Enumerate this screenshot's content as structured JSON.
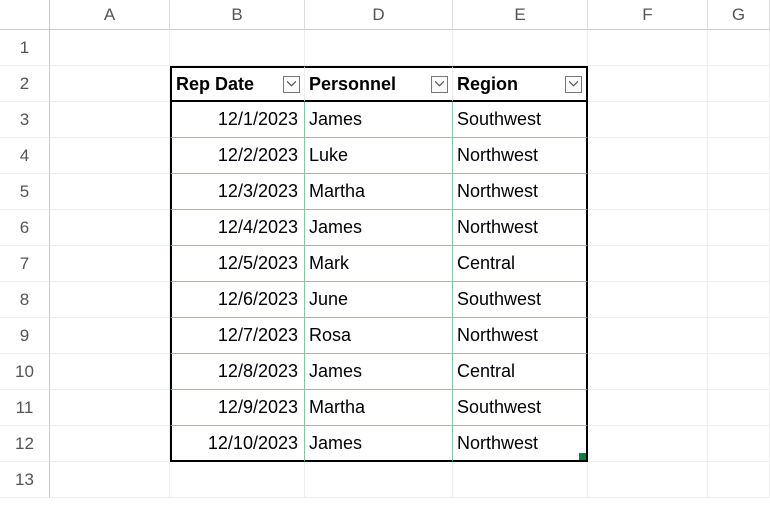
{
  "columns": [
    "A",
    "B",
    "D",
    "E",
    "F",
    "G"
  ],
  "row_numbers": [
    1,
    2,
    3,
    4,
    5,
    6,
    7,
    8,
    9,
    10,
    11,
    12,
    13
  ],
  "headers": {
    "b": "Rep Date",
    "d": "Personnel",
    "e": "Region"
  },
  "rows": [
    {
      "date": "12/1/2023",
      "personnel": "James",
      "region": "Southwest"
    },
    {
      "date": "12/2/2023",
      "personnel": "Luke",
      "region": "Northwest"
    },
    {
      "date": "12/3/2023",
      "personnel": "Martha",
      "region": "Northwest"
    },
    {
      "date": "12/4/2023",
      "personnel": "James",
      "region": "Northwest"
    },
    {
      "date": "12/5/2023",
      "personnel": "Mark",
      "region": "Central"
    },
    {
      "date": "12/6/2023",
      "personnel": "June",
      "region": "Southwest"
    },
    {
      "date": "12/7/2023",
      "personnel": "Rosa",
      "region": "Northwest"
    },
    {
      "date": "12/8/2023",
      "personnel": "James",
      "region": "Central"
    },
    {
      "date": "12/9/2023",
      "personnel": "Martha",
      "region": "Southwest"
    },
    {
      "date": "12/10/2023",
      "personnel": "James",
      "region": "Northwest"
    }
  ]
}
